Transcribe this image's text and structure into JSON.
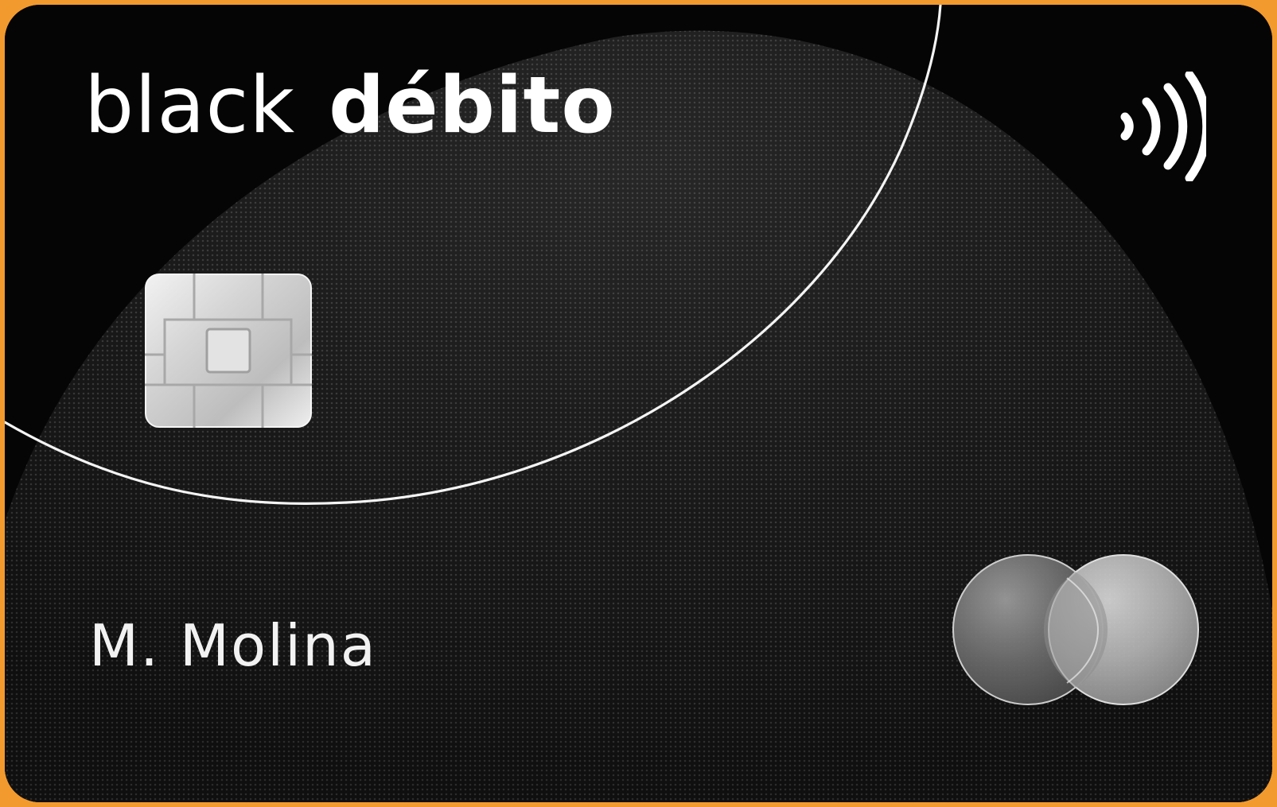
{
  "card": {
    "brand_primary": "black",
    "brand_secondary": "débito",
    "holder_name": "M. Molina",
    "network_logo_icon": "mastercard-logo-icon",
    "chip_icon": "chip-icon",
    "contactless_icon": "contactless-icon"
  },
  "colors": {
    "frame": "#f29a2e",
    "card_base": "#050505",
    "card_texture": "#2f2f2f",
    "text": "#ffffff",
    "chip": "#d8d8d8",
    "mastercard_left": "#6f6f6f",
    "mastercard_right": "#b9b9b9"
  }
}
